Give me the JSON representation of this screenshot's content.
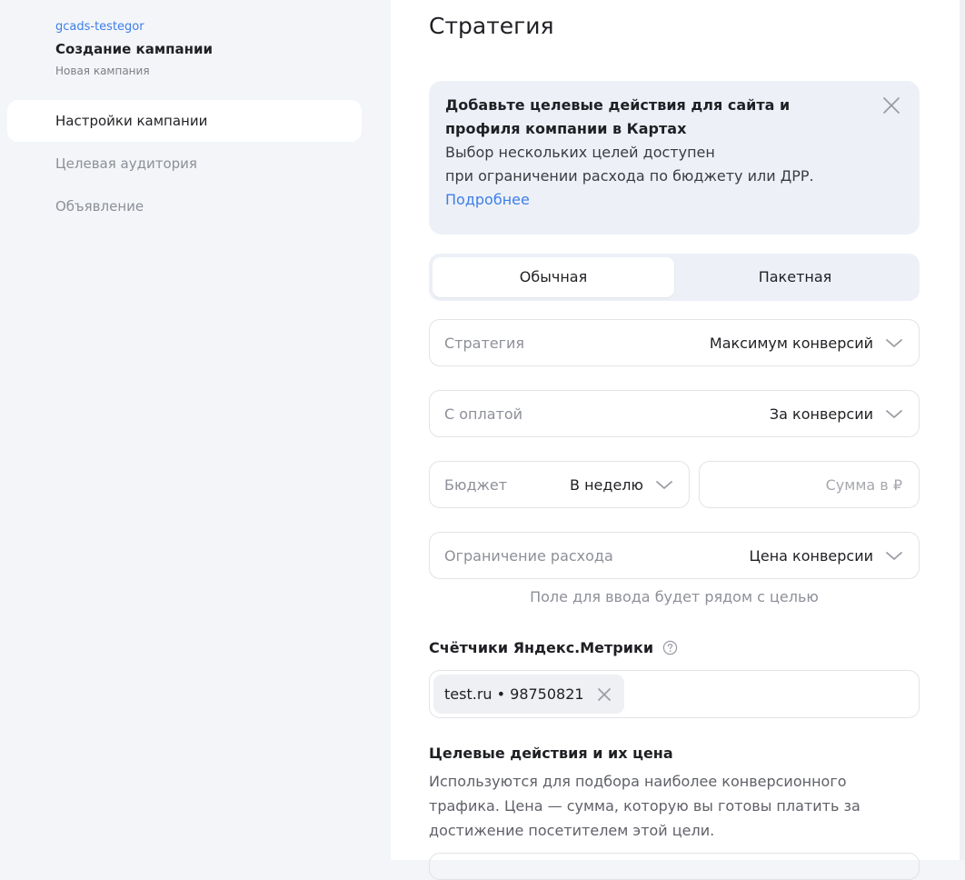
{
  "sidebar": {
    "account": "gcads-testegor",
    "title": "Создание кампании",
    "subtitle": "Новая кампания",
    "items": [
      {
        "label": "Настройки кампании"
      },
      {
        "label": "Целевая аудитория"
      },
      {
        "label": "Объявление"
      }
    ]
  },
  "main": {
    "title": "Стратегия",
    "notice": {
      "title": "Добавьте целевые действия для сайта и профиля компании в Картах",
      "text_line1": "Выбор нескольких целей доступен",
      "text_line2": "при ограничении расхода по бюджету или ДРР.",
      "link": "Подробнее"
    },
    "segment": {
      "options": [
        "Обычная",
        "Пакетная"
      ],
      "selected": "Обычная"
    },
    "strategy": {
      "label": "Стратегия",
      "value": "Максимум конверсий"
    },
    "payment": {
      "label": "С оплатой",
      "value": "За конверсии"
    },
    "budget": {
      "label": "Бюджет",
      "value": "В неделю"
    },
    "amount": {
      "placeholder": "Сумма в ₽",
      "value": ""
    },
    "limit": {
      "label": "Ограничение расхода",
      "value": "Цена конверсии"
    },
    "limit_hint": "Поле для ввода будет рядом с целью",
    "metrika": {
      "title": "Счётчики Яндекс.Метрики",
      "chip": "test.ru • 98750821"
    },
    "goals": {
      "title": "Целевые действия и их цена",
      "description": "Используются для подбора наиболее конверсионного трафика. Цена — сумма, которую вы готовы платить за достижение посетителем этой цели."
    }
  },
  "colors": {
    "accent": "#3d7ee9",
    "sidebar_bg": "#f3f5f8",
    "notice_bg": "#edf1f7",
    "border": "#e1e3e7"
  },
  "icons": {
    "close": "close-icon",
    "chevron": "chevron-down-icon",
    "help": "question-circle-icon"
  }
}
